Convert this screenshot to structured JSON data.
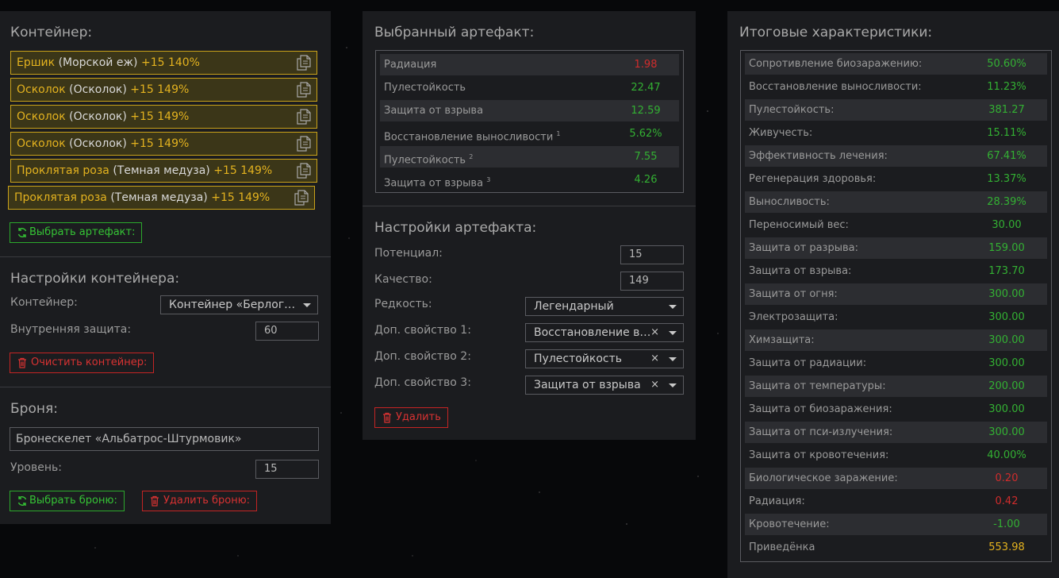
{
  "colors": {
    "green": "#33b033",
    "red": "#d02c2c",
    "gold": "#e3b21f"
  },
  "left": {
    "container_title": "Контейнер:",
    "artifacts": [
      {
        "name": "Ершик",
        "type": "(Морской еж)",
        "level": "+15 140%"
      },
      {
        "name": "Осколок",
        "type": "(Осколок)",
        "level": "+15 149%"
      },
      {
        "name": "Осколок",
        "type": "(Осколок)",
        "level": "+15 149%"
      },
      {
        "name": "Осколок",
        "type": "(Осколок)",
        "level": "+15 149%"
      },
      {
        "name": "Проклятая роза",
        "type": "(Темная медуза)",
        "level": "+15 149%"
      },
      {
        "name": "Проклятая роза",
        "type": "(Темная медуза)",
        "level": "+15 149%"
      }
    ],
    "select_artifact_label": "Выбрать артефакт:",
    "container_settings_title": "Настройки контейнера:",
    "container_label": "Контейнер:",
    "container_value": "Контейнер «Берлога…",
    "inner_protection_label": "Внутренняя защита:",
    "inner_protection_value": "60",
    "clear_container_label": "Очистить контейнер:",
    "armor_title": "Броня:",
    "armor_value": "Бронескелет «Альбатрос-Штурмовик»",
    "level_label": "Уровень:",
    "level_value": "15",
    "select_armor_label": "Выбрать броню:",
    "delete_armor_label": "Удалить броню:"
  },
  "middle": {
    "selected_title": "Выбранный артефакт:",
    "stats": [
      {
        "label": "Радиация",
        "sup": "",
        "value": "1.98",
        "color": "red"
      },
      {
        "label": "Пулестойкость",
        "sup": "",
        "value": "22.47",
        "color": "green"
      },
      {
        "label": "Защита от взрыва",
        "sup": "",
        "value": "12.59",
        "color": "green"
      },
      {
        "label": "Восстановление выносливости",
        "sup": "1",
        "value": "5.62%",
        "color": "green"
      },
      {
        "label": "Пулестойкость",
        "sup": "2",
        "value": "7.55",
        "color": "green"
      },
      {
        "label": "Защита от взрыва",
        "sup": "3",
        "value": "4.26",
        "color": "green"
      }
    ],
    "settings_title": "Настройки артефакта:",
    "potential_label": "Потенциал:",
    "potential_value": "15",
    "quality_label": "Качество:",
    "quality_value": "149",
    "rarity_label": "Редкость:",
    "rarity_value": "Легендарный",
    "prop1_label": "Доп. свойство 1:",
    "prop1_value": "Восстановление в…",
    "prop2_label": "Доп. свойство 2:",
    "prop2_value": "Пулестойкость",
    "prop3_label": "Доп. свойство 3:",
    "prop3_value": "Защита от взрыва",
    "clear_symbol": "×",
    "delete_label": "Удалить"
  },
  "right": {
    "title": "Итоговые характеристики:",
    "stats": [
      {
        "label": "Сопротивление биозаражению:",
        "value": "50.60%",
        "color": "green"
      },
      {
        "label": "Восстановление выносливости:",
        "value": "11.23%",
        "color": "green"
      },
      {
        "label": "Пулестойкость:",
        "value": "381.27",
        "color": "green"
      },
      {
        "label": "Живучесть:",
        "value": "15.11%",
        "color": "green"
      },
      {
        "label": "Эффективность лечения:",
        "value": "67.41%",
        "color": "green"
      },
      {
        "label": "Регенерация здоровья:",
        "value": "13.37%",
        "color": "green"
      },
      {
        "label": "Выносливость:",
        "value": "28.39%",
        "color": "green"
      },
      {
        "label": "Переносимый вес:",
        "value": "30.00",
        "color": "green"
      },
      {
        "label": "Защита от разрыва:",
        "value": "159.00",
        "color": "green"
      },
      {
        "label": "Защита от взрыва:",
        "value": "173.70",
        "color": "green"
      },
      {
        "label": "Защита от огня:",
        "value": "300.00",
        "color": "green"
      },
      {
        "label": "Электрозащита:",
        "value": "300.00",
        "color": "green"
      },
      {
        "label": "Химзащита:",
        "value": "300.00",
        "color": "green"
      },
      {
        "label": "Защита от радиации:",
        "value": "300.00",
        "color": "green"
      },
      {
        "label": "Защита от температуры:",
        "value": "200.00",
        "color": "green"
      },
      {
        "label": "Защита от биозаражения:",
        "value": "300.00",
        "color": "green"
      },
      {
        "label": "Защита от пси-излучения:",
        "value": "300.00",
        "color": "green"
      },
      {
        "label": "Защита от кровотечения:",
        "value": "40.00%",
        "color": "green"
      },
      {
        "label": "Биологическое заражение:",
        "value": "0.20",
        "color": "red"
      },
      {
        "label": "Радиация:",
        "value": "0.42",
        "color": "red"
      },
      {
        "label": "Кровотечение:",
        "value": "-1.00",
        "color": "green"
      },
      {
        "label": "Приведёнка",
        "value": "553.98",
        "color": "gold"
      }
    ]
  }
}
